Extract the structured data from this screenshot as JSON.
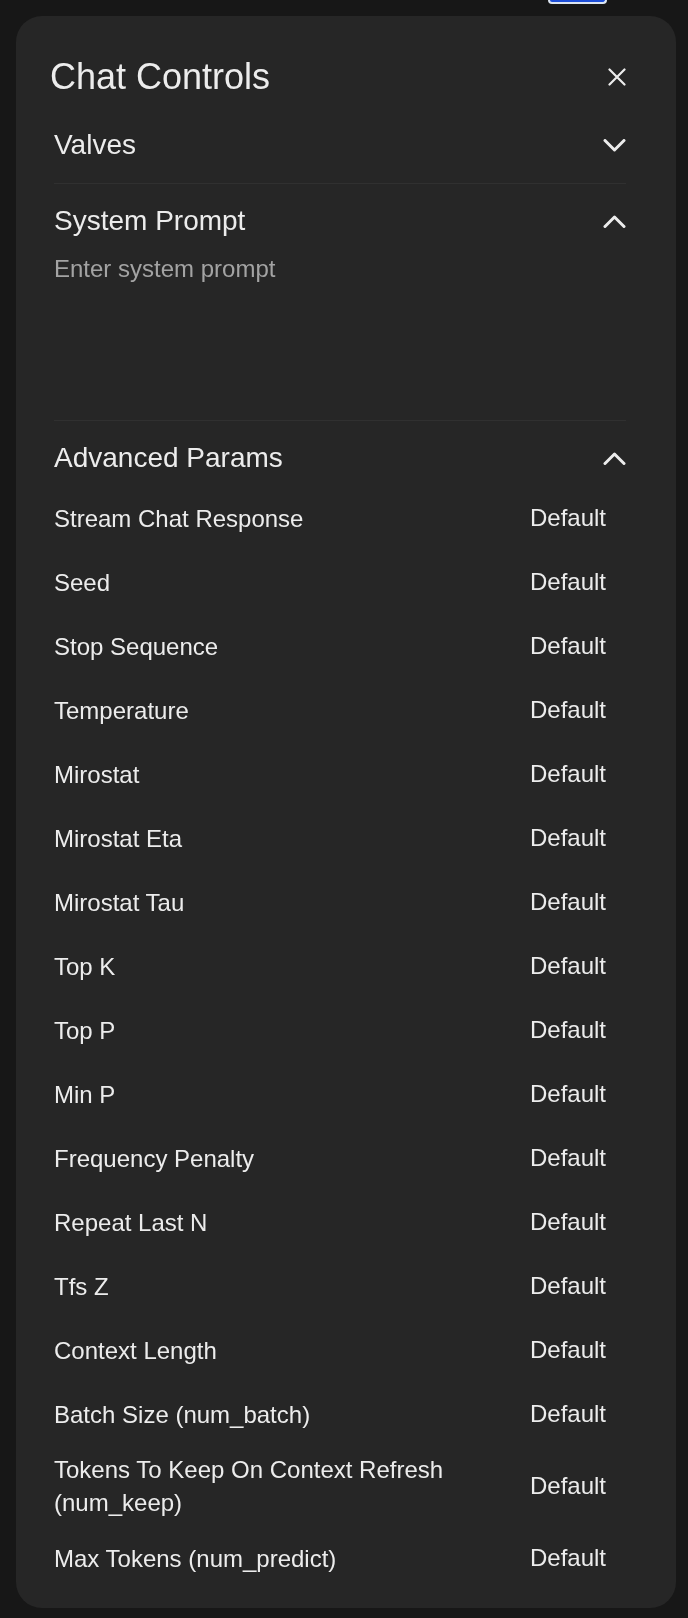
{
  "panel": {
    "title": "Chat Controls"
  },
  "sections": [
    {
      "kind": "valves",
      "title": "Valves",
      "expanded": false
    },
    {
      "kind": "prompt",
      "title": "System Prompt",
      "expanded": true,
      "placeholder": "Enter system prompt"
    },
    {
      "kind": "params",
      "title": "Advanced Params",
      "expanded": true,
      "params": [
        {
          "name": "Stream Chat Response",
          "value": "Default"
        },
        {
          "name": "Seed",
          "value": "Default"
        },
        {
          "name": "Stop Sequence",
          "value": "Default"
        },
        {
          "name": "Temperature",
          "value": "Default"
        },
        {
          "name": "Mirostat",
          "value": "Default"
        },
        {
          "name": "Mirostat Eta",
          "value": "Default"
        },
        {
          "name": "Mirostat Tau",
          "value": "Default"
        },
        {
          "name": "Top K",
          "value": "Default"
        },
        {
          "name": "Top P",
          "value": "Default"
        },
        {
          "name": "Min P",
          "value": "Default"
        },
        {
          "name": "Frequency Penalty",
          "value": "Default"
        },
        {
          "name": "Repeat Last N",
          "value": "Default"
        },
        {
          "name": "Tfs Z",
          "value": "Default"
        },
        {
          "name": "Context Length",
          "value": "Default"
        },
        {
          "name": "Batch Size (num_batch)",
          "value": "Default"
        },
        {
          "name": "Tokens To Keep On Context Refresh (num_keep)",
          "value": "Default"
        },
        {
          "name": "Max Tokens (num_predict)",
          "value": "Default"
        }
      ]
    }
  ]
}
